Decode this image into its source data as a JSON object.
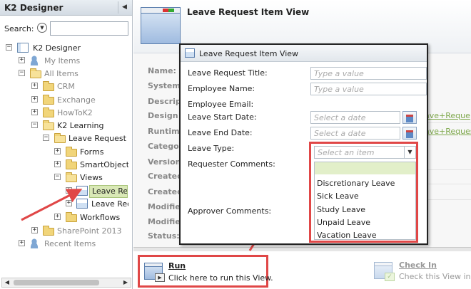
{
  "left_panel": {
    "title": "K2 Designer",
    "collapse_glyph": "◀",
    "search_label": "Search:",
    "search_value": "",
    "tree": [
      {
        "toggle": "−",
        "icon": "designer",
        "label": "K2 Designer",
        "color": "dark"
      },
      {
        "toggle": "+",
        "icon": "person",
        "label": "My Items",
        "color": "grey"
      },
      {
        "toggle": "−",
        "icon": "folder-open",
        "label": "All Items",
        "color": "grey"
      },
      {
        "toggle": "+",
        "icon": "folder",
        "label": "CRM",
        "color": "grey"
      },
      {
        "toggle": "+",
        "icon": "folder",
        "label": "Exchange",
        "color": "grey"
      },
      {
        "toggle": "+",
        "icon": "folder",
        "label": "HowToK2",
        "color": "grey"
      },
      {
        "toggle": "−",
        "icon": "folder-open",
        "label": "K2 Learning",
        "color": "dark"
      },
      {
        "toggle": "−",
        "icon": "folder-open",
        "label": "Leave Request",
        "color": "dark"
      },
      {
        "toggle": "+",
        "icon": "folder",
        "label": "Forms",
        "color": "dark"
      },
      {
        "toggle": "+",
        "icon": "folder",
        "label": "SmartObjects",
        "color": "dark"
      },
      {
        "toggle": "−",
        "icon": "folder-open",
        "label": "Views",
        "color": "dark"
      },
      {
        "toggle": "+",
        "icon": "view",
        "label": "Leave Req",
        "color": "dark",
        "selected": true
      },
      {
        "toggle": "+",
        "icon": "view",
        "label": "Leave Req",
        "color": "dark"
      },
      {
        "toggle": "+",
        "icon": "folder",
        "label": "Workflows",
        "color": "dark"
      },
      {
        "toggle": "+",
        "icon": "folder",
        "label": "SharePoint 2013",
        "color": "grey"
      },
      {
        "toggle": "+",
        "icon": "person",
        "label": "Recent Items",
        "color": "grey"
      }
    ]
  },
  "main": {
    "title": "Leave Request Item View",
    "properties": [
      "Name:",
      "System",
      "Descript",
      "Design T",
      "Runtime",
      "Catego",
      "Version",
      "Created",
      "Created",
      "Modified",
      "Modified",
      "Status:"
    ],
    "link_fragments": [
      "ave+Reque",
      "ave+Reques"
    ]
  },
  "actions": {
    "run": {
      "title": "Run",
      "description": "Click here to run this View."
    },
    "checkin": {
      "title": "Check In",
      "description": "Check this View in."
    }
  },
  "popup": {
    "title": "Leave Request Item View",
    "fields": {
      "leave_request_title": {
        "label": "Leave Request Title:",
        "placeholder": "Type a value"
      },
      "employee_name": {
        "label": "Employee Name:",
        "placeholder": "Type a value"
      },
      "employee_email": {
        "label": "Employee Email:"
      },
      "leave_start_date": {
        "label": "Leave Start Date:",
        "placeholder": "Select a date"
      },
      "leave_end_date": {
        "label": "Leave End Date:",
        "placeholder": "Select a date"
      },
      "leave_type": {
        "label": "Leave Type:",
        "placeholder": "Select an item"
      },
      "requester_comments": {
        "label": "Requester Comments:"
      },
      "approver_comments": {
        "label": "Approver Comments:"
      }
    },
    "leave_type_options": [
      "Discretionary Leave",
      "Sick Leave",
      "Study Leave",
      "Unpaid Leave",
      "Vacation Leave"
    ]
  },
  "colors": {
    "highlight": "#e04747",
    "selection": "#d9e8b6",
    "link": "#7ea84b"
  }
}
